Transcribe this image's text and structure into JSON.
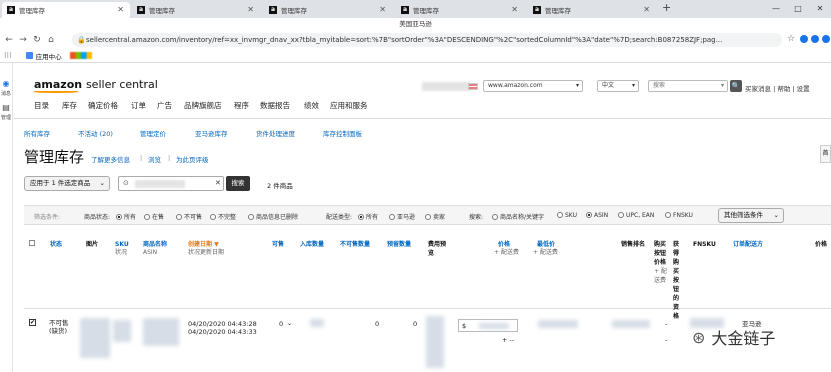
{
  "browser": {
    "tabs": [
      {
        "title": "管理库存",
        "active": true
      },
      {
        "title": "管理库存",
        "active": false
      },
      {
        "title": "管理库存",
        "active": false
      },
      {
        "title": "管理库存",
        "active": false
      },
      {
        "title": "管理库存",
        "active": false
      }
    ],
    "new_tab": "+",
    "window_controls": [
      "—",
      "□",
      "✕"
    ],
    "window_subtitle": "美国亚马逊",
    "url": "sellercentral.amazon.com/inventory/ref=xx_invmgr_dnav_xx?tbla_myitable=sort:%7B\"sortOrder\"%3A\"DESCENDING\"%2C\"sortedColumnId\"%3A\"date\"%7D;search:B087258ZJF;pag...",
    "bookmarks": [
      {
        "label": "应用中心"
      }
    ]
  },
  "rail": {
    "items": [
      "消息",
      "管理"
    ]
  },
  "header": {
    "logo_a": "amazon",
    "logo_b": "seller central",
    "marketplace": "www.amazon.com",
    "language": "中文",
    "search_placeholder": "搜索",
    "links": "买家消息 | 帮助 | 设置",
    "nav": [
      "目录",
      "库存",
      "确定价格",
      "订单",
      "广告",
      "品牌旗舰店",
      "程序",
      "数据报告",
      "绩效",
      "应用和服务"
    ]
  },
  "subnav": [
    "所有库存",
    "不活动 (20)",
    "管理定价",
    "亚马逊库存",
    "货件处理进度",
    "库存控制面板"
  ],
  "page": {
    "title": "管理库存",
    "learn_more": "了解更多信息",
    "tour": "浏览",
    "rate": "为此页评级",
    "bulk_action": "应用于 1 件选定商品",
    "search_button": "搜索",
    "result_count": "2 件商品",
    "side_tab": "首"
  },
  "filters": {
    "label": "筛选条件:",
    "status_label": "商品状态:",
    "status_options": [
      "所有",
      "在售",
      "不可售",
      "不完整",
      "商品信息已删除"
    ],
    "status_selected": 0,
    "fulfill_label": "配送类型:",
    "fulfill_options": [
      "所有",
      "亚马逊",
      "卖家"
    ],
    "fulfill_selected": 0,
    "search_label": "搜索:",
    "search_options": [
      "商品名称/关键字",
      "SKU",
      "ASIN",
      "UPC, EAN",
      "FNSKU"
    ],
    "search_selected": 2,
    "more_button": "其他筛选条件"
  },
  "table": {
    "headers": {
      "status": "状态",
      "image": "图片",
      "sku": "SKU",
      "sku_sub": "状况",
      "name": "商品名称",
      "name_sub": "ASIN",
      "created": "创建日期 ▼",
      "created_sub": "状况更新日期",
      "available": "可售",
      "inbound": "入库数量",
      "unfulfillable": "不可售数量",
      "reserved": "预留数量",
      "fee_preview": "费用预览",
      "price": "价格",
      "price_sub": "+ 配送费",
      "lowest_price": "最低价",
      "lowest_sub": "+ 配送费",
      "sales_rank": "销售排名",
      "buybox": "购买按钮价格",
      "buybox_sub": "+ 配送费",
      "buybox_elig": "获得购买按钮的资格",
      "fnsku": "FNSKU",
      "fulfilled_by": "订单配送方",
      "price2": "价格"
    },
    "row": {
      "status": "不可售(缺货)",
      "created": "04/20/2020 04:43:28",
      "updated": "04/20/2020 04:43:33",
      "available": "0",
      "unfulfillable": "0",
      "reserved": "0",
      "currency": "$",
      "price_add": "+ --",
      "buybox": "-",
      "buybox_elig": "-",
      "fulfilled_by": "亚马逊"
    }
  },
  "watermark": {
    "text": "大金链子"
  }
}
